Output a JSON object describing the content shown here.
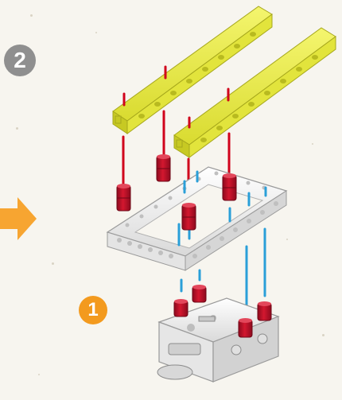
{
  "steps": {
    "step_1": "1",
    "step_2": "2"
  },
  "colors": {
    "badge_step_1": "#f39a1e",
    "badge_step_2": "#8f8f8f",
    "arrow": "#f7a531",
    "beam": "#e6e84a",
    "connector_peg": "#c8102e",
    "guide_red": "#d0021b",
    "guide_blue": "#2a9fd8",
    "frame": "#f2f2f2"
  },
  "icons": {
    "arrow": "arrow-right-icon"
  }
}
